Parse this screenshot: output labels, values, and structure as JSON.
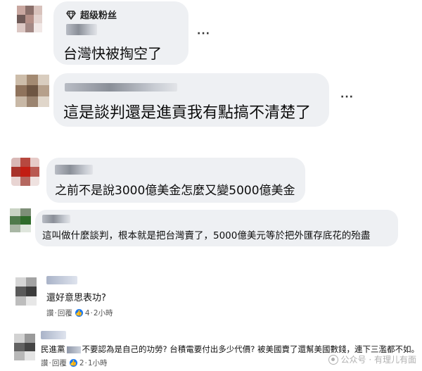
{
  "comments": [
    {
      "badge": "超级粉丝",
      "text": "台灣快被掏空了",
      "more": "···"
    },
    {
      "text": "這是談判還是進貢我有點搞不清楚了",
      "more": "···"
    },
    {
      "text": "之前不是說3000億美金怎麼又變5000億美金"
    },
    {
      "text": "這叫做什麼談判，根本就是把台灣賣了，5000億美元等於把外匯存底花的殆盡"
    },
    {
      "text": "還好意思表功?",
      "actions": {
        "like": "讚",
        "dot": "·",
        "reply": "回覆",
        "like_count": "4",
        "time": "2小時"
      }
    },
    {
      "text_prefix": "民進黨",
      "text": "不要認為是自己的功勞? 台積電要付出多少代價? 被美國賣了還幫美國數錢，連下三濫都不如。",
      "actions": {
        "like": "讚",
        "dot": "·",
        "reply": "回覆",
        "like_count": "2",
        "time": "1小時"
      }
    }
  ],
  "watermark": "公众号 · 有理儿有面",
  "colors": {
    "bubble": "#eef0f3",
    "like_blue": "#1877f2"
  }
}
